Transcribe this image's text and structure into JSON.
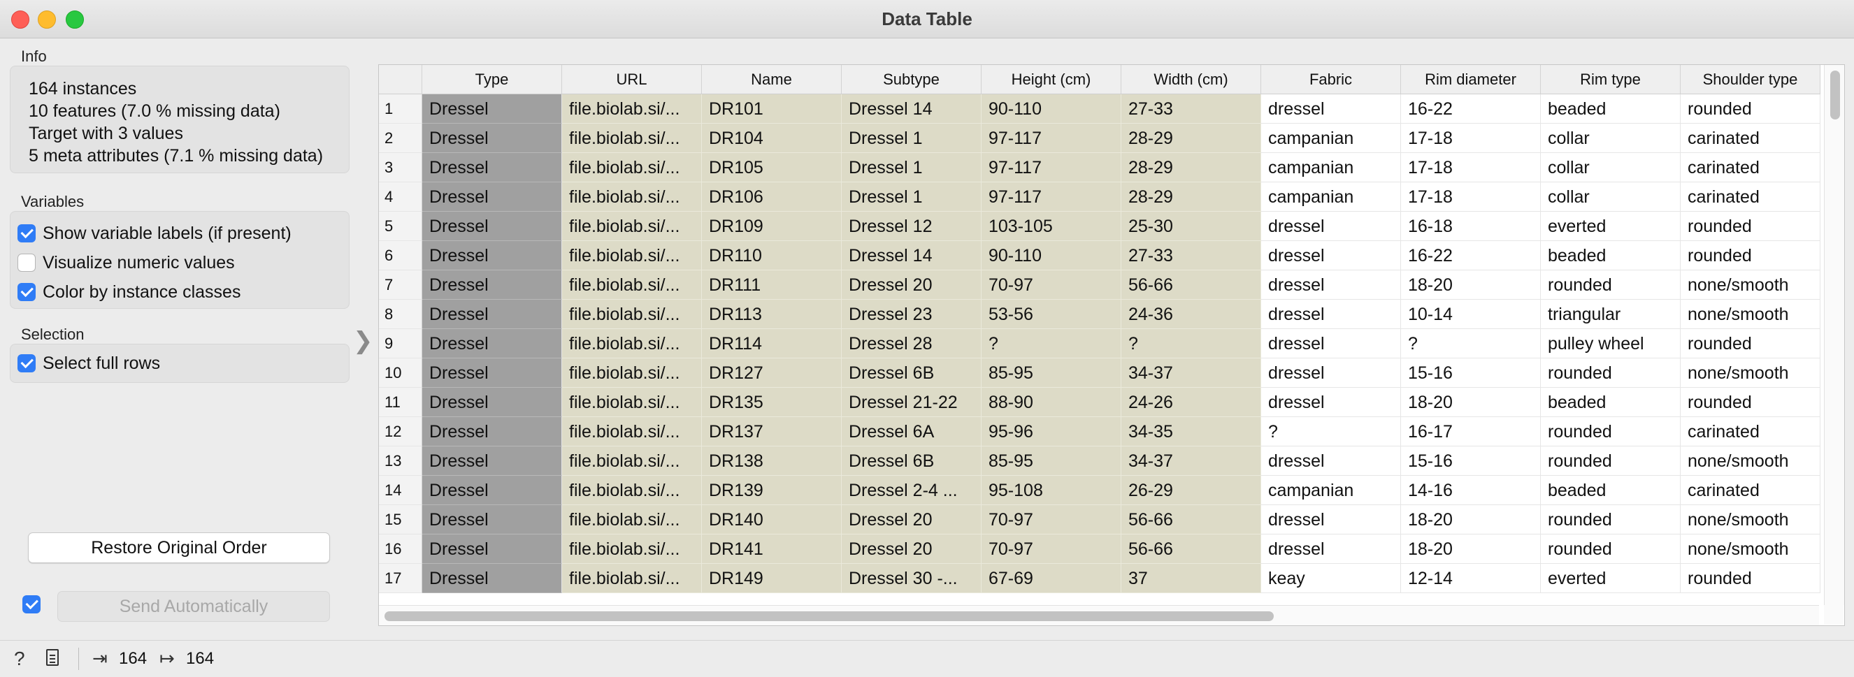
{
  "window": {
    "title": "Data Table"
  },
  "info": {
    "title": "Info",
    "lines": [
      "164 instances",
      "10 features (7.0 % missing data)",
      "Target with 3 values",
      "5 meta attributes (7.1 % missing data)"
    ]
  },
  "variables": {
    "title": "Variables",
    "options": [
      {
        "label": "Show variable labels (if present)",
        "checked": true
      },
      {
        "label": "Visualize numeric values",
        "checked": false
      },
      {
        "label": "Color by instance classes",
        "checked": true
      }
    ]
  },
  "selection": {
    "title": "Selection",
    "options": [
      {
        "label": "Select full rows",
        "checked": true
      }
    ]
  },
  "buttons": {
    "restore": "Restore Original Order",
    "send": "Send Automatically",
    "send_auto_checked": true
  },
  "colors": {
    "accent": "#2f7cf6",
    "class_col": "#a0a0a0",
    "meta_col": "#dddbc7"
  },
  "table": {
    "columns": [
      "Type",
      "URL",
      "Name",
      "Subtype",
      "Height (cm)",
      "Width (cm)",
      "Fabric",
      "Rim diameter",
      "Rim type",
      "Shoulder type"
    ],
    "rows": [
      [
        "1",
        "Dressel",
        "file.biolab.si/...",
        "DR101",
        "Dressel 14",
        "90-110",
        "27-33",
        "dressel",
        "16-22",
        "beaded",
        "rounded"
      ],
      [
        "2",
        "Dressel",
        "file.biolab.si/...",
        "DR104",
        "Dressel 1",
        "97-117",
        "28-29",
        "campanian",
        "17-18",
        "collar",
        "carinated"
      ],
      [
        "3",
        "Dressel",
        "file.biolab.si/...",
        "DR105",
        "Dressel 1",
        "97-117",
        "28-29",
        "campanian",
        "17-18",
        "collar",
        "carinated"
      ],
      [
        "4",
        "Dressel",
        "file.biolab.si/...",
        "DR106",
        "Dressel 1",
        "97-117",
        "28-29",
        "campanian",
        "17-18",
        "collar",
        "carinated"
      ],
      [
        "5",
        "Dressel",
        "file.biolab.si/...",
        "DR109",
        "Dressel 12",
        "103-105",
        "25-30",
        "dressel",
        "16-18",
        "everted",
        "rounded"
      ],
      [
        "6",
        "Dressel",
        "file.biolab.si/...",
        "DR110",
        "Dressel 14",
        "90-110",
        "27-33",
        "dressel",
        "16-22",
        "beaded",
        "rounded"
      ],
      [
        "7",
        "Dressel",
        "file.biolab.si/...",
        "DR111",
        "Dressel 20",
        "70-97",
        "56-66",
        "dressel",
        "18-20",
        "rounded",
        "none/smooth"
      ],
      [
        "8",
        "Dressel",
        "file.biolab.si/...",
        "DR113",
        "Dressel 23",
        "53-56",
        "24-36",
        "dressel",
        "10-14",
        "triangular",
        "none/smooth"
      ],
      [
        "9",
        "Dressel",
        "file.biolab.si/...",
        "DR114",
        "Dressel 28",
        "?",
        "?",
        "dressel",
        "?",
        "pulley wheel",
        "rounded"
      ],
      [
        "10",
        "Dressel",
        "file.biolab.si/...",
        "DR127",
        "Dressel 6B",
        "85-95",
        "34-37",
        "dressel",
        "15-16",
        "rounded",
        "none/smooth"
      ],
      [
        "11",
        "Dressel",
        "file.biolab.si/...",
        "DR135",
        "Dressel 21-22",
        "88-90",
        "24-26",
        "dressel",
        "18-20",
        "beaded",
        "rounded"
      ],
      [
        "12",
        "Dressel",
        "file.biolab.si/...",
        "DR137",
        "Dressel 6A",
        "95-96",
        "34-35",
        "?",
        "16-17",
        "rounded",
        "carinated"
      ],
      [
        "13",
        "Dressel",
        "file.biolab.si/...",
        "DR138",
        "Dressel 6B",
        "85-95",
        "34-37",
        "dressel",
        "15-16",
        "rounded",
        "none/smooth"
      ],
      [
        "14",
        "Dressel",
        "file.biolab.si/...",
        "DR139",
        "Dressel 2-4 ...",
        "95-108",
        "26-29",
        "campanian",
        "14-16",
        "beaded",
        "carinated"
      ],
      [
        "15",
        "Dressel",
        "file.biolab.si/...",
        "DR140",
        "Dressel 20",
        "70-97",
        "56-66",
        "dressel",
        "18-20",
        "rounded",
        "none/smooth"
      ],
      [
        "16",
        "Dressel",
        "file.biolab.si/...",
        "DR141",
        "Dressel 20",
        "70-97",
        "56-66",
        "dressel",
        "18-20",
        "rounded",
        "none/smooth"
      ],
      [
        "17",
        "Dressel",
        "file.biolab.si/...",
        "DR149",
        "Dressel 30 -...",
        "67-69",
        "37",
        "keay",
        "12-14",
        "everted",
        "rounded"
      ]
    ]
  },
  "status": {
    "input_count": "164",
    "output_count": "164"
  }
}
